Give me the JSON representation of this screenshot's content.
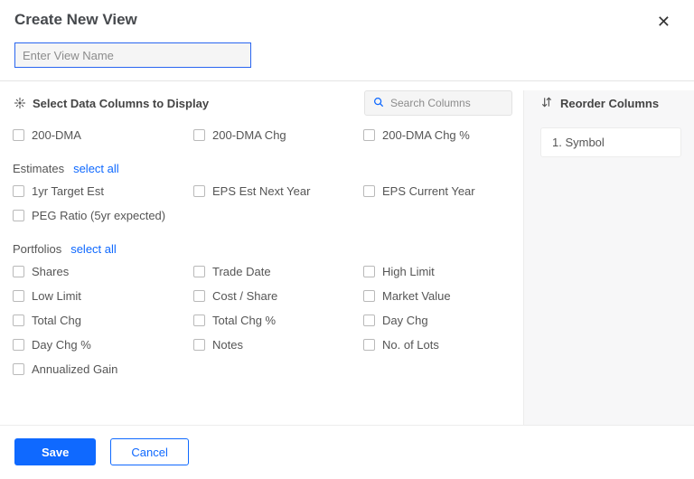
{
  "header": {
    "title": "Create New View"
  },
  "view_name": {
    "placeholder": "Enter View Name",
    "value": ""
  },
  "select_columns_label": "Select Data Columns to Display",
  "search": {
    "placeholder": "Search Columns",
    "value": ""
  },
  "top_row_items": [
    "200-DMA",
    "200-DMA Chg",
    "200-DMA Chg %"
  ],
  "groups": [
    {
      "name": "Estimates",
      "select_all_label": "select all",
      "items": [
        "1yr Target Est",
        "EPS Est Next Year",
        "EPS Current Year",
        "PEG Ratio (5yr expected)"
      ]
    },
    {
      "name": "Portfolios",
      "select_all_label": "select all",
      "items": [
        "Shares",
        "Trade Date",
        "High Limit",
        "Low Limit",
        "Cost / Share",
        "Market Value",
        "Total Chg",
        "Total Chg %",
        "Day Chg",
        "Day Chg %",
        "Notes",
        "No. of Lots",
        "Annualized Gain"
      ]
    }
  ],
  "reorder": {
    "heading": "Reorder Columns",
    "items": [
      "1. Symbol"
    ]
  },
  "footer": {
    "save_label": "Save",
    "cancel_label": "Cancel"
  }
}
